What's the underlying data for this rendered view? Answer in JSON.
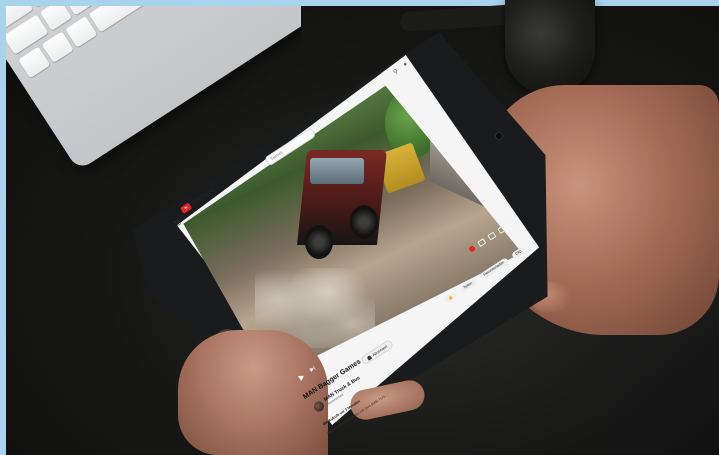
{
  "app": {
    "logo_text": "YouTube",
    "search_placeholder": "Suchen"
  },
  "video": {
    "title": "MAN Bagger Games",
    "channel_name": "MAN Truck & Bus",
    "channel_subscribers": "Abonnenten",
    "subscribe_label": "Abonniert",
    "actions": {
      "share_label": "Teilen",
      "download_label": "Herunterladen",
      "clip_label": "Clip"
    },
    "description": [
      "466 Aufrufe  vor 3 Monaten",
      "Baggern auf Wallisergart mit dem MAN TGS..."
    ]
  },
  "colors": {
    "accent_red": "#e3262a",
    "background_blue": "#a9d4ee",
    "desk": "#171716"
  },
  "icons": {
    "menu": "hamburger-icon",
    "logo": "youtube-logo-icon",
    "search": "search-icon",
    "notification": "bell-icon",
    "play": "play-icon",
    "next": "skip-next-icon"
  }
}
